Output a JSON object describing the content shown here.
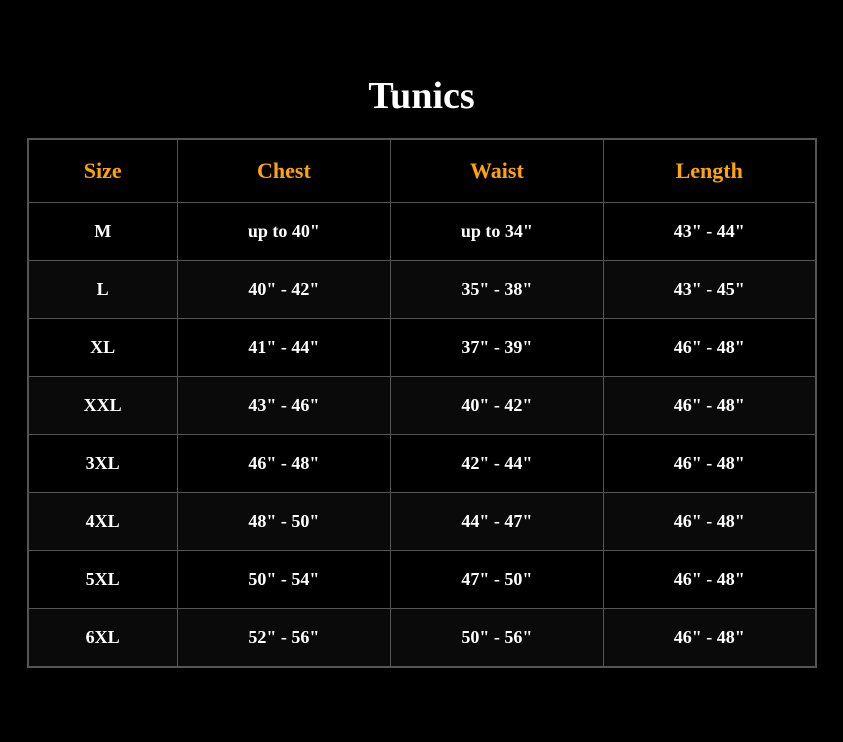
{
  "page": {
    "title": "Tunics",
    "background_color": "#000000"
  },
  "table": {
    "headers": {
      "size": "Size",
      "chest": "Chest",
      "waist": "Waist",
      "length": "Length"
    },
    "rows": [
      {
        "size": "M",
        "chest": "up to 40\"",
        "waist": "up to 34\"",
        "length": "43\" - 44\""
      },
      {
        "size": "L",
        "chest": "40\" - 42\"",
        "waist": "35\" - 38\"",
        "length": "43\" - 45\""
      },
      {
        "size": "XL",
        "chest": "41\" - 44\"",
        "waist": "37\" - 39\"",
        "length": "46\" - 48\""
      },
      {
        "size": "XXL",
        "chest": "43\" - 46\"",
        "waist": "40\" - 42\"",
        "length": "46\" - 48\""
      },
      {
        "size": "3XL",
        "chest": "46\" - 48\"",
        "waist": "42\" - 44\"",
        "length": "46\" - 48\""
      },
      {
        "size": "4XL",
        "chest": "48\" - 50\"",
        "waist": "44\" - 47\"",
        "length": "46\" - 48\""
      },
      {
        "size": "5XL",
        "chest": "50\" - 54\"",
        "waist": "47\" - 50\"",
        "length": "46\" - 48\""
      },
      {
        "size": "6XL",
        "chest": "52\" - 56\"",
        "waist": "50\" - 56\"",
        "length": "46\" - 48\""
      }
    ]
  }
}
